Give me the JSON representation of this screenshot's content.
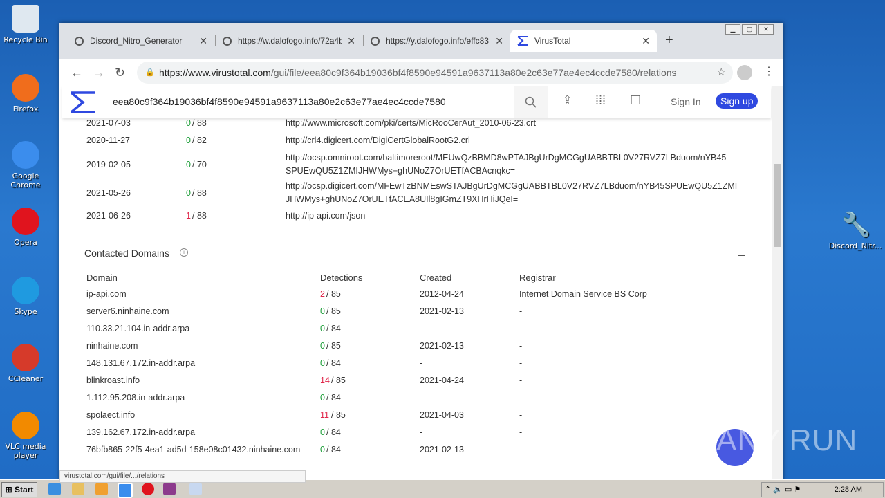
{
  "desktop": {
    "icons": [
      {
        "label": "Recycle Bin",
        "color": "#dfe8f0"
      },
      {
        "label": "Firefox",
        "color": "#f06d1c"
      },
      {
        "label": "Google Chrome",
        "color": "#3b8ded"
      },
      {
        "label": "Opera",
        "color": "#e0141e"
      },
      {
        "label": "Skype",
        "color": "#1f9ae0"
      },
      {
        "label": "CCleaner",
        "color": "#d63a2a"
      },
      {
        "label": "VLC media player",
        "color": "#f28a00"
      }
    ],
    "right_icon": "Discord_Nitr...",
    "watermark": "ANY RUN"
  },
  "browser": {
    "tabs": [
      {
        "title": "Discord_Nitro_Generator"
      },
      {
        "title": "https://w.dalofogo.info/72a4b"
      },
      {
        "title": "https://y.dalofogo.info/effc83"
      },
      {
        "title": "VirusTotal"
      }
    ],
    "url_host": "https://www.virustotal.com",
    "url_path": "/gui/file/eea80c9f364b19036bf4f8590e94591a9637113a80e2c63e77ae4ec4ccde7580/relations",
    "status_url": "virustotal.com/gui/file/.../relations"
  },
  "vt": {
    "search_hash": "eea80c9f364b19036bf4f8590e94591a9637113a80e2c63e77ae4ec4ccde7580",
    "sign_in": "Sign In",
    "sign_up": "Sign up",
    "urls": [
      {
        "date": "2021-07-03",
        "det": "0",
        "total": " / 88",
        "url": "http://www.microsoft.com/pki/certs/MicRooCerAut_2010-06-23.crt",
        "url2": ""
      },
      {
        "date": "2020-11-27",
        "det": "0",
        "total": " / 82",
        "url": "http://crl4.digicert.com/DigiCertGlobalRootG2.crl",
        "url2": ""
      },
      {
        "date": "2019-02-05",
        "det": "0",
        "total": " / 70",
        "url": "http://ocsp.omniroot.com/baltimoreroot/MEUwQzBBMD8wPTAJBgUrDgMCGgUABBTBL0V27RVZ7LBduom/nYB45",
        "url2": "SPUEwQU5Z1ZMIJHWMys+ghUNoZ7OrUETfACBAcnqkc="
      },
      {
        "date": "2021-05-26",
        "det": "0",
        "total": " / 88",
        "url": "http://ocsp.digicert.com/MFEwTzBNMEswSTAJBgUrDgMCGgUABBTBL0V27RVZ7LBduom/nYB45SPUEwQU5Z1ZMI",
        "url2": "JHWMys+ghUNoZ7OrUETfACEA8UIl8gIGmZT9XHrHiJQeI="
      },
      {
        "date": "2021-06-26",
        "det": "1",
        "total": " / 88",
        "url": "http://ip-api.com/json",
        "url2": ""
      }
    ],
    "domains_title": "Contacted Domains",
    "domain_headers": {
      "domain": "Domain",
      "detections": "Detections",
      "created": "Created",
      "registrar": "Registrar"
    },
    "domains": [
      {
        "domain": "ip-api.com",
        "det": "2",
        "total": " / 85",
        "created": "2012-04-24",
        "registrar": "Internet Domain Service BS Corp"
      },
      {
        "domain": "server6.ninhaine.com",
        "det": "0",
        "total": " / 85",
        "created": "2021-02-13",
        "registrar": "-"
      },
      {
        "domain": "110.33.21.104.in-addr.arpa",
        "det": "0",
        "total": " / 84",
        "created": "-",
        "registrar": "-"
      },
      {
        "domain": "ninhaine.com",
        "det": "0",
        "total": " / 85",
        "created": "2021-02-13",
        "registrar": "-"
      },
      {
        "domain": "148.131.67.172.in-addr.arpa",
        "det": "0",
        "total": " / 84",
        "created": "-",
        "registrar": "-"
      },
      {
        "domain": "blinkroast.info",
        "det": "14",
        "total": " / 85",
        "created": "2021-04-24",
        "registrar": "-"
      },
      {
        "domain": "1.112.95.208.in-addr.arpa",
        "det": "0",
        "total": " / 84",
        "created": "-",
        "registrar": "-"
      },
      {
        "domain": "spolaect.info",
        "det": "11",
        "total": " / 85",
        "created": "2021-04-03",
        "registrar": "-"
      },
      {
        "domain": "139.162.67.172.in-addr.arpa",
        "det": "0",
        "total": " / 84",
        "created": "-",
        "registrar": "-"
      },
      {
        "domain": "76bfb865-22f5-4ea1-ad5d-158e08c01432.ninhaine.com",
        "det": "0",
        "total": " / 84",
        "created": "2021-02-13",
        "registrar": "-"
      }
    ]
  },
  "taskbar": {
    "start": "Start",
    "clock": "2:28 AM"
  }
}
